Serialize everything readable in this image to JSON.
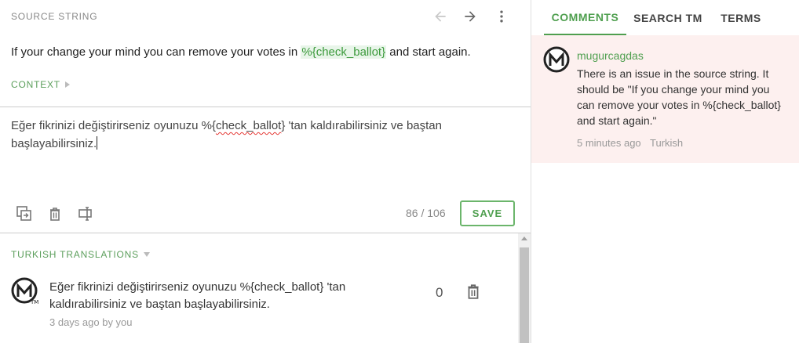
{
  "source": {
    "label": "SOURCE STRING",
    "text_before": "If your change your mind you can remove your votes in",
    "placeable": "%{check_ballot}",
    "text_after": "and start again.",
    "context_label": "CONTEXT"
  },
  "nav": {
    "prev_icon": "arrow-left-icon",
    "next_icon": "arrow-right-icon",
    "more_icon": "more-vertical-icon"
  },
  "editor": {
    "text_before": "Eğer fikrinizi değiştirirseniz oyunuzu %{",
    "misspelled": "check_ballot",
    "text_after": "} 'tan kaldırabilirsiniz ve baştan başlayabilirsiniz.",
    "counter": "86 / 106",
    "save_label": "SAVE"
  },
  "translations": {
    "label": "TURKISH TRANSLATIONS",
    "items": [
      {
        "text": "Eğer fikrinizi değiştirirseniz oyunuzu %{check_ballot} 'tan kaldırabilirsiniz ve baştan başlayabilirsiniz.",
        "meta": "3 days ago by you",
        "votes": "0"
      }
    ]
  },
  "tabs": [
    {
      "label": "COMMENTS",
      "active": true
    },
    {
      "label": "SEARCH TM",
      "active": false
    },
    {
      "label": "TERMS",
      "active": false
    }
  ],
  "comment": {
    "author": "mugurcagdas",
    "text": "There is an issue in the source string. It should be \"If you change your mind you can remove your votes in %{check_ballot} and start again.\"",
    "time": "5 minutes ago",
    "locale": "Turkish"
  },
  "colors": {
    "accent": "#4f9f4f",
    "comment_bg": "#fdf0ef",
    "placeable_bg": "#e8f5e9"
  }
}
